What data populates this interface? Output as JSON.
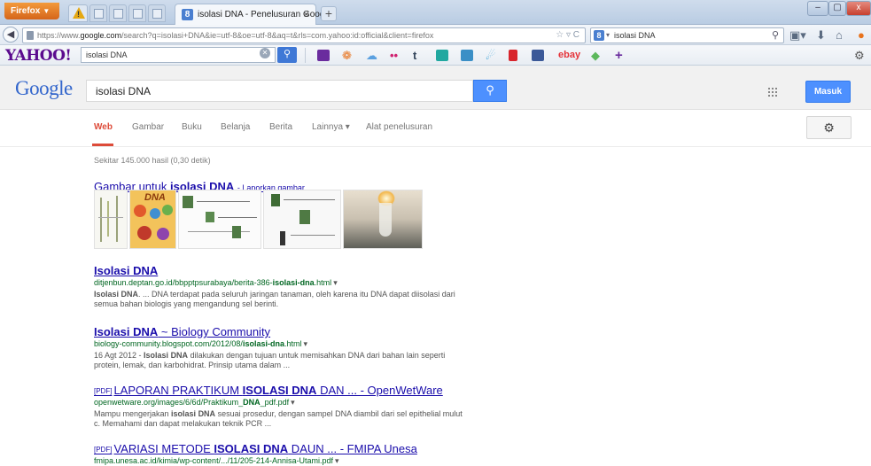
{
  "browser": {
    "firefox_button": "Firefox",
    "active_tab_title": "isolasi DNA - Penelusuran Google",
    "tab_close": "×",
    "new_tab": "+",
    "address_prefix": "https://www.",
    "address_domain": "google.com",
    "address_rest": "/search?q=isolasi+DNA&ie=utf-8&oe=utf-8&aq=t&rls=com.yahoo:id:official&client=firefox",
    "search_engine_query": "isolasi DNA",
    "window_buttons": {
      "minimize": "–",
      "maximize": "▢",
      "close": "x"
    }
  },
  "yahoo_toolbar": {
    "logo": "YAHOO!",
    "query": "isolasi DNA",
    "ebay_label": "ebay",
    "icons": [
      "mail-icon",
      "flickr-icon",
      "weather-icon",
      "dots-icon",
      "tumblr-icon",
      "photos-icon",
      "news-icon",
      "sports-icon",
      "bookmark-icon",
      "facebook-icon",
      "ebay-icon",
      "tag-icon",
      "plus-icon"
    ],
    "colors": {
      "logo": "#5b0b8e",
      "go_button": "#3f78d6"
    }
  },
  "google": {
    "logo": "Google",
    "query": "isolasi DNA",
    "signin_label": "Masuk",
    "tabs": [
      {
        "label": "Web",
        "active": true
      },
      {
        "label": "Gambar",
        "active": false
      },
      {
        "label": "Buku",
        "active": false
      },
      {
        "label": "Belanja",
        "active": false
      },
      {
        "label": "Berita",
        "active": false
      },
      {
        "label": "Lainnya ▾",
        "active": false
      },
      {
        "label": "Alat penelusuran",
        "active": false
      }
    ],
    "result_stats": "Sekitar 145.000 hasil (0,30 detik)",
    "images_heading_prefix": "Gambar untuk ",
    "images_heading_bold": "isolasi DNA",
    "images_report": "Laporkan gambar",
    "colors": {
      "link": "#1a0dab",
      "url": "#006621",
      "accent": "#dd4b39",
      "button": "#4d90fe"
    }
  },
  "results": [
    {
      "title_plain": "",
      "title_bold": "Isolasi DNA",
      "title_suffix": "",
      "url_pre": "ditjenbun.deptan.go.id/bbpptpsurabaya/berita-386-",
      "url_bold": "isolasi-dna",
      "url_post": ".html",
      "snippet_b1": "Isolasi DNA",
      "snippet_t1": ". ... DNA terdapat pada seluruh jaringan tanaman, oleh karena itu DNA dapat diisolasi dari semua bahan biologis yang mengandung sel berinti."
    },
    {
      "title_plain": "",
      "title_bold": "Isolasi DNA",
      "title_suffix": " ~ Biology Community",
      "url_pre": "biology-community.blogspot.com/2012/08/",
      "url_bold": "isolasi-dna",
      "url_post": ".html",
      "snippet_t0": "16 Agt 2012 - ",
      "snippet_b1": "Isolasi DNA",
      "snippet_t1": " dilakukan dengan tujuan untuk memisahkan DNA dari bahan lain seperti protein, lemak, dan karbohidrat. Prinsip utama dalam ..."
    },
    {
      "pdf_tag": "[PDF]",
      "title_plain": "LAPORAN PRAKTIKUM ",
      "title_bold": "ISOLASI DNA",
      "title_suffix": " DAN ... - OpenWetWare",
      "url_pre": "openwetware.org/images/6/6d/Praktikum_",
      "url_bold": "DNA",
      "url_post": "_pdf.pdf",
      "snippet_t0": "Mampu mengerjakan ",
      "snippet_b1": "isolasi DNA",
      "snippet_t1": " sesuai prosedur, dengan sampel DNA diambil dari sel epithelial mulut c. Memahami dan dapat melakukan teknik PCR ..."
    },
    {
      "pdf_tag": "[PDF]",
      "title_plain": "VARIASI METODE ",
      "title_bold": "ISOLASI DNA",
      "title_suffix": " DAUN ... - FMIPA Unesa",
      "url_pre": "fmipa.unesa.ac.id/kimia/wp-content/.../11/205-214-Annisa-Utami.pdf",
      "url_bold": "",
      "url_post": ""
    }
  ]
}
